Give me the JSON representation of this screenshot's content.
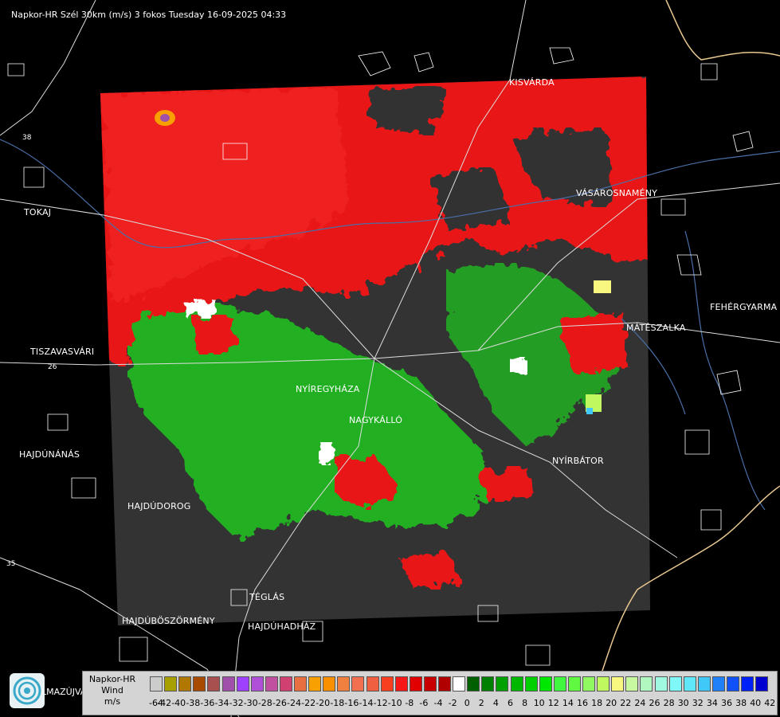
{
  "header": {
    "title": "Napkor-HR Szél 30km (m/s) 3 fokos Tuesday 16-09-2025 04:33"
  },
  "cities": [
    {
      "key": "kisvarda",
      "label": "KISVÁRDA"
    },
    {
      "key": "tokaj",
      "label": "TOKAJ"
    },
    {
      "key": "vasarosnameny",
      "label": "VÁSÁROSNAMÉNY"
    },
    {
      "key": "fehergyarmat",
      "label": "FEHÉRGYARMA"
    },
    {
      "key": "mateszalka",
      "label": "MÁTÉSZALKA"
    },
    {
      "key": "tiszavasvari",
      "label": "TISZAVASVÁRI"
    },
    {
      "key": "nyiregyhaza",
      "label": "NYÍREGYHÁZA"
    },
    {
      "key": "nagykallo",
      "label": "NAGYKÁLLÓ"
    },
    {
      "key": "hajdunanas",
      "label": "HAJDÚNÁNÁS"
    },
    {
      "key": "nyirbator",
      "label": "NYÍRBÁTOR"
    },
    {
      "key": "hajdudorog",
      "label": "HAJDÚDOROG"
    },
    {
      "key": "teglas",
      "label": "TÉGLÁS"
    },
    {
      "key": "hajduboszormeny",
      "label": "HAJDÚBÖSZÖRMÉNY"
    },
    {
      "key": "hajduhadhaz",
      "label": "HAJDÚHADHÁZ"
    },
    {
      "key": "hajdusamson",
      "label": "LMAZÚJVÁR"
    }
  ],
  "roads": {
    "r26": "26",
    "r35": "35",
    "r38": "38"
  },
  "legend": {
    "title_line1": "Napkor-HR",
    "title_line2": "Wind",
    "title_line3": "m/s",
    "ticks": [
      "-64",
      "-42",
      "-40",
      "-38",
      "-36",
      "-34",
      "-32",
      "-30",
      "-28",
      "-26",
      "-24",
      "-22",
      "-20",
      "-18",
      "-16",
      "-14",
      "-12",
      "-10",
      "-8",
      "-6",
      "-4",
      "-2",
      "0",
      "2",
      "4",
      "6",
      "8",
      "10",
      "12",
      "14",
      "16",
      "18",
      "20",
      "22",
      "24",
      "26",
      "28",
      "30",
      "32",
      "34",
      "36",
      "38",
      "40",
      "42"
    ],
    "colors": [
      "#cccccc",
      "#a8a000",
      "#b07800",
      "#a84a00",
      "#a85050",
      "#a050a8",
      "#a040ff",
      "#b050d8",
      "#c050a0",
      "#d04070",
      "#e87040",
      "#f8a000",
      "#f89000",
      "#f08040",
      "#f07050",
      "#f06040",
      "#f84020",
      "#f81818",
      "#e00000",
      "#c80000",
      "#b00000",
      "#ffffff",
      "#006000",
      "#008000",
      "#00a000",
      "#00b800",
      "#00d000",
      "#00e800",
      "#40f840",
      "#60f840",
      "#90f860",
      "#c0f860",
      "#f8f880",
      "#c8f8a0",
      "#b0f8c0",
      "#a0f8e0",
      "#80f8f8",
      "#60e8f8",
      "#40c8f8",
      "#2080f8",
      "#1050f8",
      "#0020f8",
      "#0000d0"
    ]
  },
  "colors": {
    "background": "#000000",
    "radar_no_echo": "#333333",
    "approach_red": "#e81818",
    "recede_green": "#22b022",
    "border_line": "#e8c890",
    "river_line": "#4a6fa8"
  }
}
